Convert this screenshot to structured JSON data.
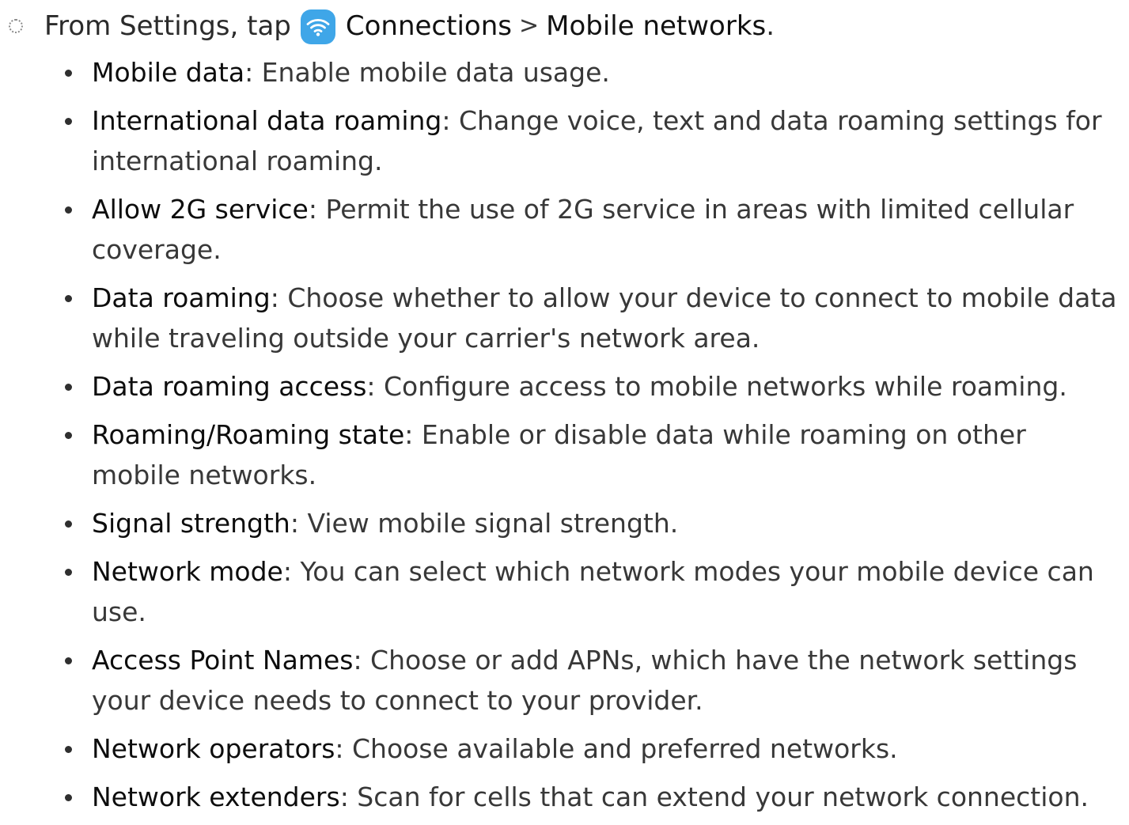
{
  "step": {
    "prefix": "From Settings, tap",
    "connections_label": "Connections",
    "separator": ">",
    "mobile_networks_label": "Mobile networks",
    "suffix": ".",
    "icon": "wifi-icon",
    "icon_color": "#3fa6e8"
  },
  "options": [
    {
      "term": "Mobile data",
      "desc": ": Enable mobile data usage."
    },
    {
      "term": "International data roaming",
      "desc": ": Change voice, text and data roaming settings for international roaming."
    },
    {
      "term": "Allow 2G service",
      "desc": ": Permit the use of 2G service in areas with limited cellular coverage."
    },
    {
      "term": "Data roaming",
      "desc": ": Choose whether to allow your device to connect to mobile data while traveling outside your carrier's network area."
    },
    {
      "term": "Data roaming access",
      "desc": ": Configure access to mobile networks while roaming."
    },
    {
      "term": "Roaming/Roaming state",
      "desc": ": Enable or disable data while roaming on other mobile networks."
    },
    {
      "term": "Signal strength",
      "desc": ": View mobile signal strength."
    },
    {
      "term": "Network mode",
      "desc": ": You can select which network modes your mobile device can use."
    },
    {
      "term": "Access Point Names",
      "desc": ": Choose or add APNs, which have the network settings your device needs to connect to your provider."
    },
    {
      "term": "Network operators",
      "desc": ": Choose available and preferred networks."
    },
    {
      "term": "Network extenders",
      "desc": ": Scan for cells that can extend your network connection."
    }
  ]
}
